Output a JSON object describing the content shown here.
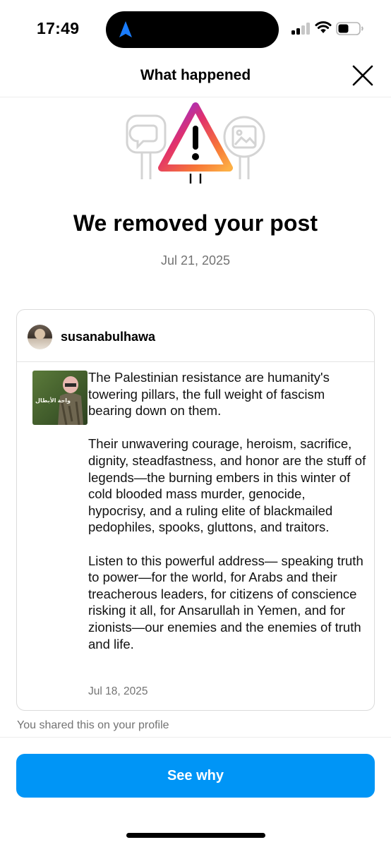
{
  "status_bar": {
    "time": "17:49"
  },
  "header": {
    "title": "What happened"
  },
  "notice": {
    "title": "We removed your post",
    "date": "Jul 21, 2025"
  },
  "post": {
    "username": "susanabulhawa",
    "thumbnail_text": "واحة الأبطال",
    "paragraphs": [
      "The Palestinian resistance are humanity's towering pillars, the full weight of fascism bearing down on them.",
      "Their unwavering courage, heroism, sacrifice, dignity, steadfastness, and honor are the stuff of legends—the burning embers in this winter of cold blooded mass murder, genocide, hypocrisy, and a ruling elite of blackmailed pedophiles, spooks, gluttons, and traitors.",
      "Listen to this powerful address— speaking truth to power—for the world, for Arabs and their treacherous leaders, for citizens of conscience risking it all, for Ansarullah in Yemen, and for zionists—our enemies and the enemies of truth and life."
    ],
    "date": "Jul 18, 2025"
  },
  "footer": {
    "shared_note": "You shared this on your profile",
    "see_why_label": "See why"
  },
  "colors": {
    "primary_button": "#0095f6",
    "muted_text": "#737373",
    "warning_gradient": [
      "#7b2ff7",
      "#e1306c",
      "#f77737",
      "#fcaf45"
    ]
  },
  "icons": [
    "navigation-arrow-icon",
    "cellular-signal-icon",
    "wifi-icon",
    "battery-icon",
    "close-icon",
    "warning-triangle-icon",
    "comment-sign-icon",
    "photo-sign-icon"
  ]
}
